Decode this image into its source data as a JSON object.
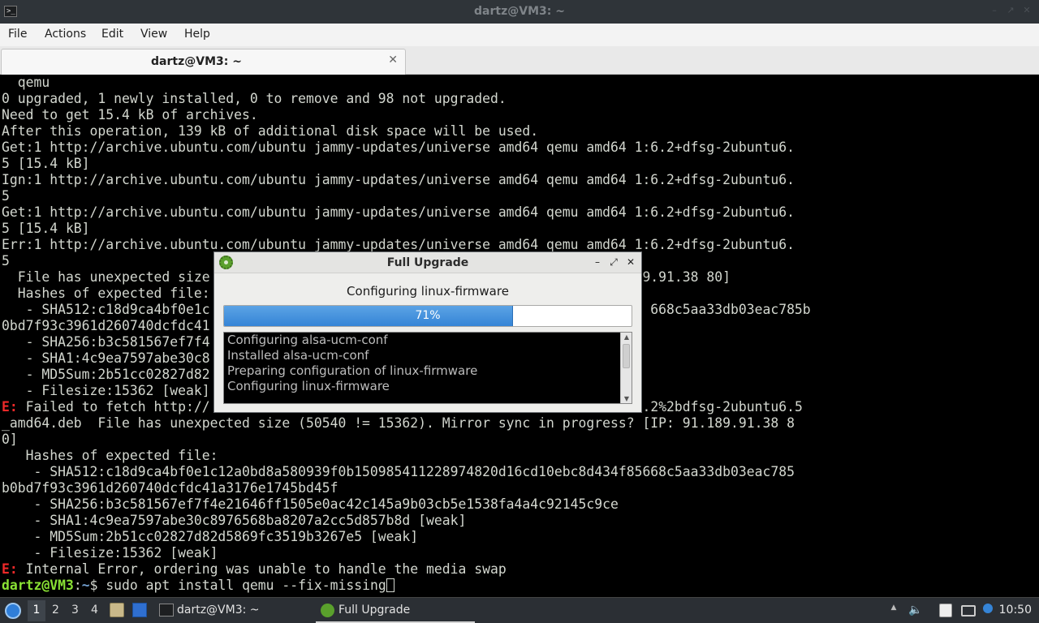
{
  "window": {
    "title": "dartz@VM3: ~",
    "minimize_glyph": "–",
    "maximize_glyph": "↗",
    "close_glyph": "✕"
  },
  "menubar": {
    "items": [
      "File",
      "Actions",
      "Edit",
      "View",
      "Help"
    ]
  },
  "tabs": [
    {
      "label": "dartz@VM3: ~",
      "close_glyph": "✕"
    }
  ],
  "terminal": {
    "lines": [
      "  qemu",
      "0 upgraded, 1 newly installed, 0 to remove and 98 not upgraded.",
      "Need to get 15.4 kB of archives.",
      "After this operation, 139 kB of additional disk space will be used.",
      "Get:1 http://archive.ubuntu.com/ubuntu jammy-updates/universe amd64 qemu amd64 1:6.2+dfsg-2ubuntu6.",
      "5 [15.4 kB]",
      "Ign:1 http://archive.ubuntu.com/ubuntu jammy-updates/universe amd64 qemu amd64 1:6.2+dfsg-2ubuntu6.",
      "5",
      "Get:1 http://archive.ubuntu.com/ubuntu jammy-updates/universe amd64 qemu amd64 1:6.2+dfsg-2ubuntu6.",
      "5 [15.4 kB]",
      "Err:1 http://archive.ubuntu.com/ubuntu jammy-updates/universe amd64 qemu amd64 1:6.2+dfsg-2ubuntu6.",
      "5",
      "  File has unexpected size                                                     89.91.38 80]",
      "  Hashes of expected file:",
      "   - SHA512:c18d9ca4bf0e1c                                                       668c5aa33db03eac785b",
      "0bd7f93c3961d260740dcfdc41",
      "   - SHA256:b3c581567ef7f4",
      "   - SHA1:4c9ea7597abe30c8",
      "   - MD5Sum:2b51cc02827d82",
      "   - Filesize:15362 [weak]",
      "E| Failed to fetch http://                                                      .2%2bdfsg-2ubuntu6.5",
      "_amd64.deb  File has unexpected size (50540 != 15362). Mirror sync in progress? [IP: 91.189.91.38 8",
      "0]",
      "   Hashes of expected file:",
      "    - SHA512:c18d9ca4bf0e1c12a0bd8a580939f0b150985411228974820d16cd10ebc8d434f85668c5aa33db03eac785",
      "b0bd7f93c3961d260740dcfdc41a3176e1745bd45f",
      "    - SHA256:b3c581567ef7f4e21646ff1505e0ac42c145a9b03cb5e1538fa4a4c92145c9ce",
      "    - SHA1:4c9ea7597abe30c8976568ba8207a2cc5d857b8d [weak]",
      "    - MD5Sum:2b51cc02827d82d5869fc3519b3267e5 [weak]",
      "    - Filesize:15362 [weak]",
      "E| Internal Error, ordering was unable to handle the media swap"
    ],
    "prompt": {
      "user_host": "dartz@VM3",
      "sep": ":",
      "path": "~",
      "symbol": "$ ",
      "command": "sudo apt install qemu --fix-missing"
    }
  },
  "dialog": {
    "title": "Full Upgrade",
    "minimize_glyph": "–",
    "maximize_glyph": "⤢",
    "close_glyph": "✕",
    "status": "Configuring linux-firmware",
    "progress_value": 71,
    "progress_label": "71%",
    "log_lines": [
      "Configuring alsa-ucm-conf",
      "Installed alsa-ucm-conf",
      "Preparing configuration of linux-firmware",
      "Configuring linux-firmware"
    ],
    "scroll_up_glyph": "▲",
    "scroll_down_glyph": "▼"
  },
  "taskbar": {
    "workspaces": [
      "1",
      "2",
      "3",
      "4"
    ],
    "active_workspace": "1",
    "tasks": [
      {
        "label": "dartz@VM3: ~",
        "icon": "terminal-icon"
      },
      {
        "label": "Full Upgrade",
        "icon": "gear-icon"
      }
    ],
    "tray_up_glyph": "▲",
    "volume_glyph": "🔈",
    "clock": "10:50"
  },
  "colors": {
    "terminal_bg": "#000000",
    "terminal_fg": "#d3d7cf",
    "error_red": "#ef2929",
    "prompt_green": "#8ae234",
    "prompt_blue": "#729fcf",
    "progress_blue": "#3584d6"
  }
}
